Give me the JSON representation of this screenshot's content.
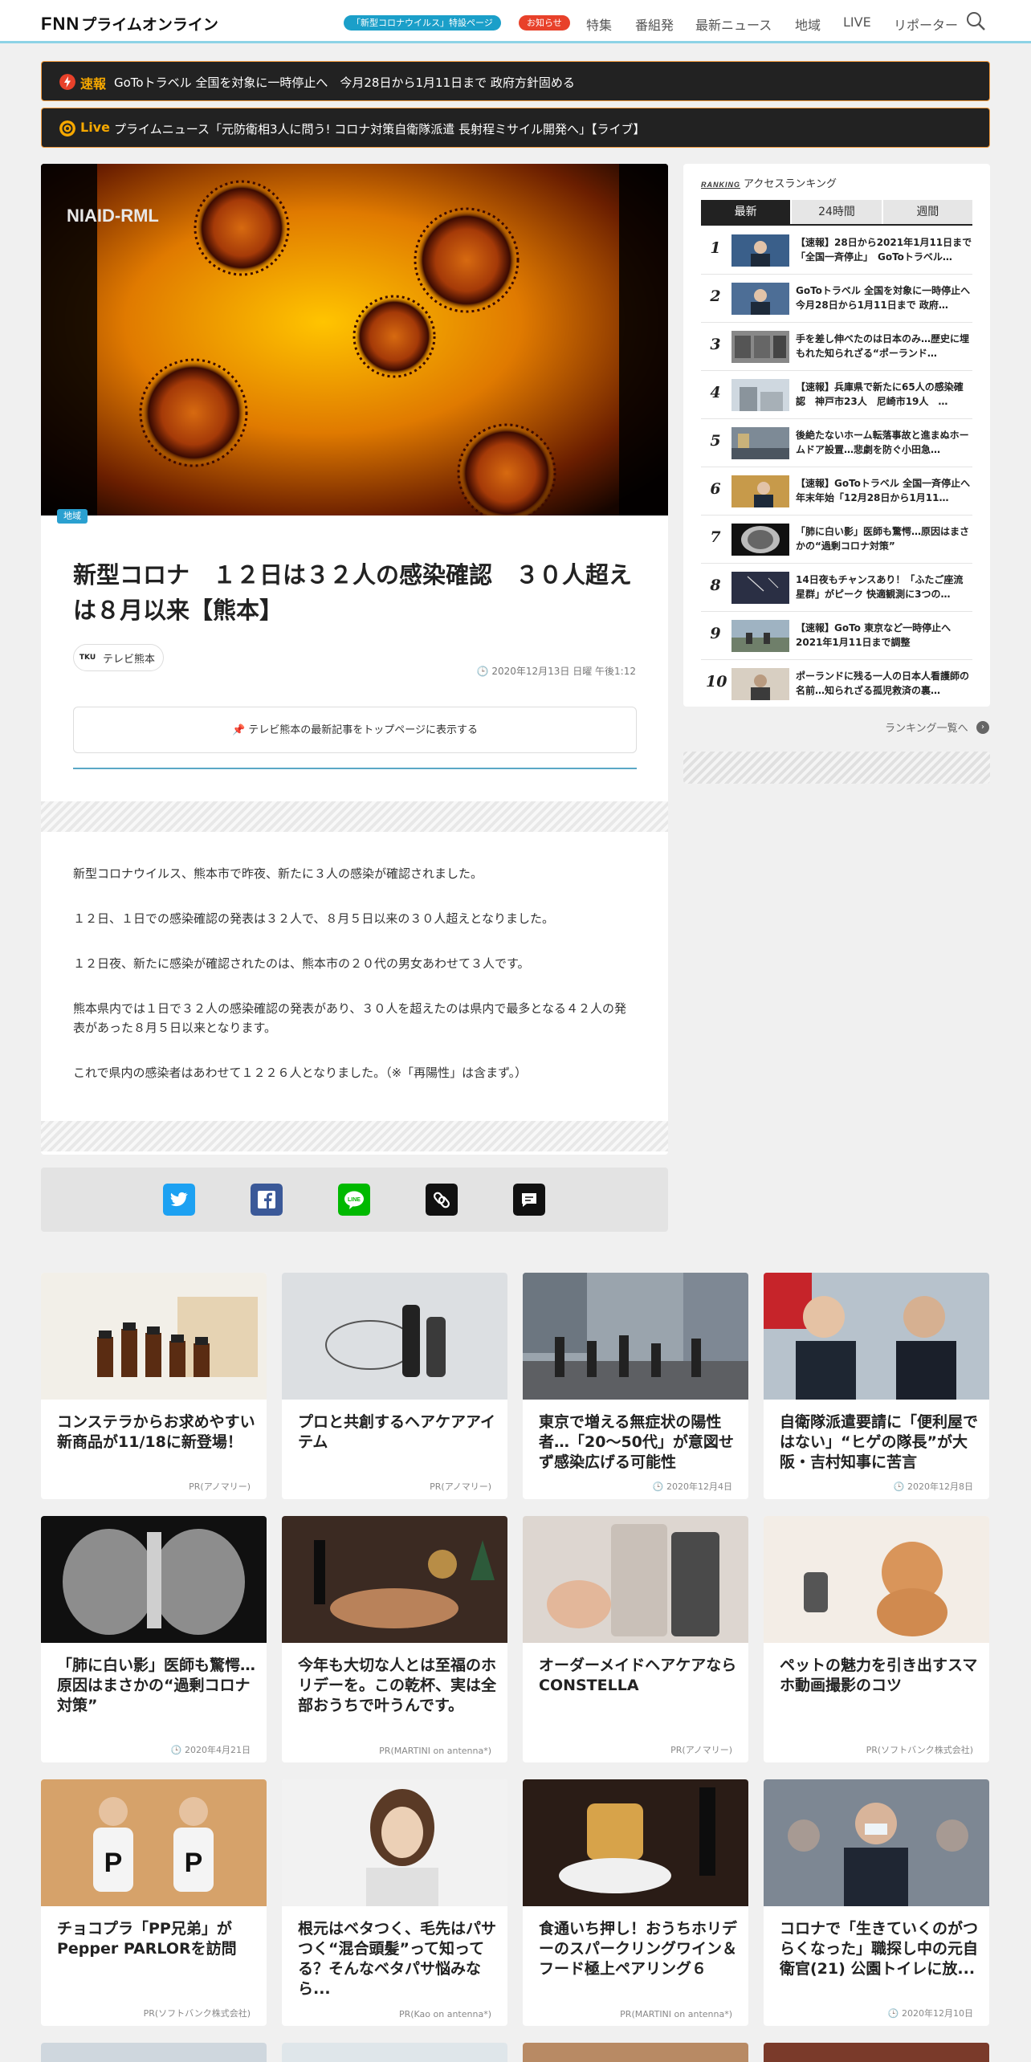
{
  "header": {
    "logo_fnn": "FNN",
    "logo_jp": "プライムオンライン",
    "pill_corona": "「新型コロナウイルス」特設ページ",
    "pill_notice": "お知らせ",
    "nav": [
      "特集",
      "番組発",
      "最新ニュース",
      "地域",
      "LIVE",
      "リポーター"
    ]
  },
  "tickers": [
    {
      "label": "速報",
      "text": "GoToトラベル 全国を対象に一時停止へ　今月28日から1月11日まで 政府方針固める"
    },
    {
      "label": "Live",
      "text": "プライムニュース「元防衛相3人に問う! コロナ対策自衛隊派遣 長射程ミサイル開発へ」【ライブ】"
    }
  ],
  "article": {
    "hero_watermark": "NIAID-RML",
    "region_badge": "地域",
    "headline": "新型コロナ　１２日は３２人の感染確認　３０人超えは８月以来【熊本】",
    "source_logo": "TKU",
    "source_name": "テレビ熊本",
    "date": "2020年12月13日 日曜 午後1:12",
    "pin_button": "テレビ熊本の最新記事をトップページに表示する",
    "paragraphs": [
      "新型コロナウイルス、熊本市で昨夜、新たに３人の感染が確認されました。",
      "１２日、１日での感染確認の発表は３２人で、８月５日以来の３０人超えとなりました。",
      "１２日夜、新たに感染が確認されたのは、熊本市の２０代の男女あわせて３人です。",
      "熊本県内では１日で３２人の感染確認の発表があり、３０人を超えたのは県内で最多となる４２人の発表があった８月５日以来となります。",
      "これで県内の感染者はあわせて１２２６人となりました。（※「再陽性」は含まず。）"
    ]
  },
  "share": {
    "colors": {
      "twitter": "#1da1f2",
      "facebook": "#3b5998",
      "line": "#00b900",
      "link": "#111111",
      "comment": "#111111"
    }
  },
  "ranking": {
    "title_en": "RANKING",
    "title": "アクセスランキング",
    "tabs": [
      "最新",
      "24時間",
      "週間"
    ],
    "items": [
      {
        "rank": "1",
        "text": "【速報】28日から2021年1月11日まで「全国一斉停止」　GoToトラベル…"
      },
      {
        "rank": "2",
        "text": "GoToトラベル 全国を対象に一時停止へ　今月28日から1月11日まで 政府…"
      },
      {
        "rank": "3",
        "text": "手を差し伸べたのは日本のみ…歴史に埋もれた知られざる“ポーランド…"
      },
      {
        "rank": "4",
        "text": "【速報】兵庫県で新たに65人の感染確認　神戸市23人　尼崎市19人　…"
      },
      {
        "rank": "5",
        "text": "後絶たないホーム転落事故と進まぬホームドア設置…悲劇を防ぐ小田急…"
      },
      {
        "rank": "6",
        "text": "【速報】GoToトラベル 全国一斉停止へ　年末年始「12月28日から1月11…"
      },
      {
        "rank": "7",
        "text": "「肺に白い影」医師も驚愕…原因はまさかの“過剰コロナ対策”"
      },
      {
        "rank": "8",
        "text": "14日夜もチャンスあり！「ふたご座流星群」がピーク 快適観測に3つの…"
      },
      {
        "rank": "9",
        "text": "【速報】GoTo 東京など一時停止へ　2021年1月11日まで調整"
      },
      {
        "rank": "10",
        "text": "ポーランドに残る一人の日本人看護師の名前…知られざる孤児救済の裏…"
      }
    ],
    "more": "ランキング一覧へ"
  },
  "cards": [
    {
      "title": "コンステラからお求めやすい新商品が11/18に新登場！",
      "meta": "PR(アノマリー)"
    },
    {
      "title": "プロと共創するヘアケアアイテム",
      "meta": "PR(アノマリー)"
    },
    {
      "title": "東京で増える無症状の陽性者…「20～50代」が意図せず感染広げる可能性",
      "meta": "2020年12月4日"
    },
    {
      "title": "自衛隊派遣要請に「便利屋ではない」“ヒゲの隊長”が大阪・吉村知事に苦言",
      "meta": "2020年12月8日"
    },
    {
      "title": "「肺に白い影」医師も驚愕…原因はまさかの“過剰コロナ対策”",
      "meta": "2020年4月21日"
    },
    {
      "title": "今年も大切な人とは至福のホリデーを。この乾杯、実は全部おうちで叶うんです。",
      "meta": "PR(MARTINI on antenna*)"
    },
    {
      "title": "オーダーメイドヘアケアならCONSTELLA",
      "meta": "PR(アノマリー)"
    },
    {
      "title": "ペットの魅力を引き出すスマホ動画撮影のコツ",
      "meta": "PR(ソフトバンク株式会社)"
    },
    {
      "title": "チョコプラ「PP兄弟」がPepper PARLORを訪問",
      "meta": "PR(ソフトバンク株式会社)"
    },
    {
      "title": "根元はベタつく、毛先はパサつく“混合頭髪”って知ってる？そんなベタパサ悩みなら...",
      "meta": "PR(Kao on antenna*)"
    },
    {
      "title": "食通いち押し！おうちホリデーのスパークリングワイン＆フード極上ペアリング６",
      "meta": "PR(MARTINI on antenna*)"
    },
    {
      "title": "コロナで「生きていくのがつらくなった」職探し中の元自衛官(21) 公園トイレに放...",
      "meta": "2020年12月10日"
    }
  ]
}
